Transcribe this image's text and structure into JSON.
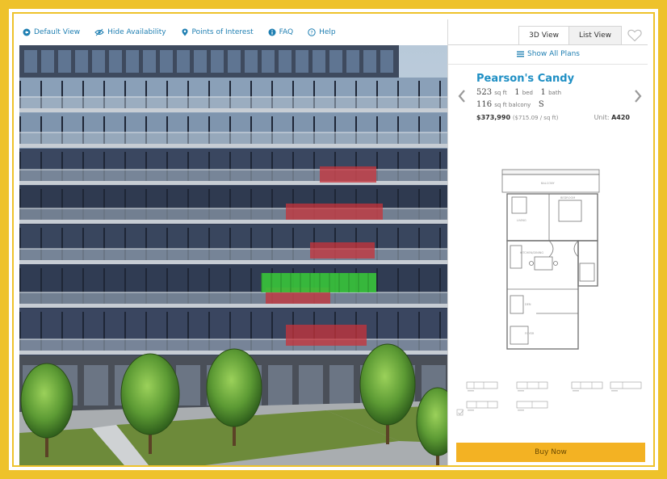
{
  "toolbar": {
    "default_view": "Default View",
    "hide_availability": "Hide Availability",
    "points_of_interest": "Points of Interest",
    "faq": "FAQ",
    "help": "Help"
  },
  "tabs": {
    "view_3d": "3D View",
    "list_view": "List View"
  },
  "show_all_plans": "Show All Plans",
  "unit": {
    "name": "Pearson's Candy",
    "sqft": "523",
    "sqft_unit": "sq ft",
    "beds": "1",
    "beds_unit": "bed",
    "baths": "1",
    "baths_unit": "bath",
    "balcony": "116",
    "balcony_unit": "sq ft balcony",
    "exposure": "S",
    "price": "$373,990",
    "price_per_sqft": "($715.09 / sq ft)",
    "unit_label": "Unit:",
    "unit_number": "A420"
  },
  "buy_now": "Buy Now",
  "colors": {
    "brand_blue": "#1f7fb2",
    "frame_gold": "#eec22b",
    "buy_orange": "#f3b223",
    "available_green": "#39c43a",
    "sold_red": "#c8333a"
  }
}
